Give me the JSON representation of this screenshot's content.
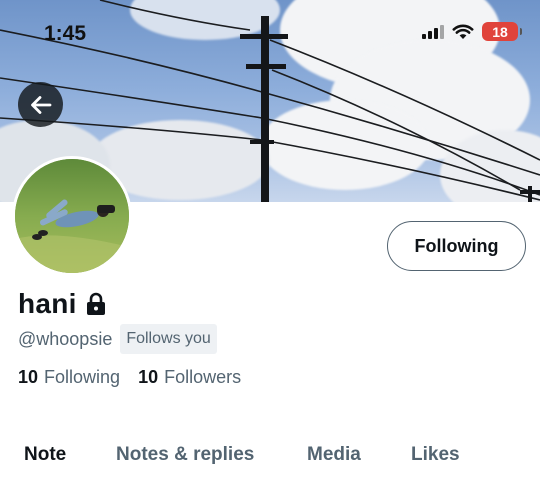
{
  "status_bar": {
    "time": "1:45",
    "battery_level": "18",
    "signal_icon": "cellular-signal-icon",
    "wifi_icon": "wifi-icon"
  },
  "header": {
    "back_icon": "arrow-left-icon"
  },
  "profile": {
    "display_name": "hani",
    "locked_icon": "lock-icon",
    "handle": "@whoopsie",
    "follows_you_badge": "Follows you",
    "following_button_label": "Following",
    "stats": {
      "following_count": "10",
      "following_label": "Following",
      "followers_count": "10",
      "followers_label": "Followers"
    }
  },
  "tabs": [
    {
      "label": "Note",
      "active": true
    },
    {
      "label": "Notes & replies",
      "active": false
    },
    {
      "label": "Media",
      "active": false
    },
    {
      "label": "Likes",
      "active": false
    }
  ],
  "colors": {
    "primary_text": "#0f1419",
    "secondary_text": "#536471",
    "battery_low": "#e0433b",
    "badge_bg": "#eef1f4"
  }
}
